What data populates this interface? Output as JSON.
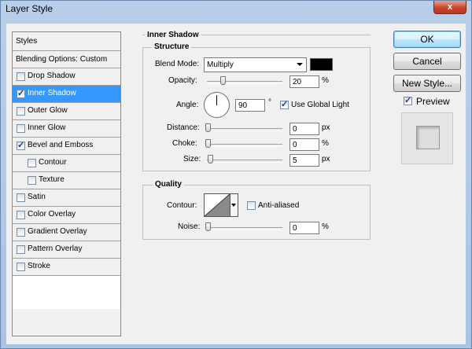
{
  "window": {
    "title": "Layer Style",
    "close_glyph": "x"
  },
  "styles_panel": {
    "header": "Styles",
    "blending": "Blending Options: Custom",
    "items": [
      {
        "label": "Drop Shadow",
        "checked": false,
        "selected": false,
        "indent": false
      },
      {
        "label": "Inner Shadow",
        "checked": true,
        "selected": true,
        "indent": false
      },
      {
        "label": "Outer Glow",
        "checked": false,
        "selected": false,
        "indent": false
      },
      {
        "label": "Inner Glow",
        "checked": false,
        "selected": false,
        "indent": false
      },
      {
        "label": "Bevel and Emboss",
        "checked": true,
        "selected": false,
        "indent": false
      },
      {
        "label": "Contour",
        "checked": false,
        "selected": false,
        "indent": true
      },
      {
        "label": "Texture",
        "checked": false,
        "selected": false,
        "indent": true
      },
      {
        "label": "Satin",
        "checked": false,
        "selected": false,
        "indent": false
      },
      {
        "label": "Color Overlay",
        "checked": false,
        "selected": false,
        "indent": false
      },
      {
        "label": "Gradient Overlay",
        "checked": false,
        "selected": false,
        "indent": false
      },
      {
        "label": "Pattern Overlay",
        "checked": false,
        "selected": false,
        "indent": false
      },
      {
        "label": "Stroke",
        "checked": false,
        "selected": false,
        "indent": false
      }
    ]
  },
  "inner_shadow": {
    "title": "Inner Shadow",
    "structure": {
      "title": "Structure",
      "blend_mode_label": "Blend Mode:",
      "blend_mode_value": "Multiply",
      "shadow_color": "#000000",
      "opacity_label": "Opacity:",
      "opacity_value": "20",
      "opacity_unit": "%",
      "opacity_level": 0.2,
      "angle_label": "Angle:",
      "angle_value": "90",
      "angle_unit": "°",
      "use_global_light_label": "Use Global Light",
      "use_global_light_checked": true,
      "distance_label": "Distance:",
      "distance_value": "0",
      "distance_unit": "px",
      "distance_level": 0,
      "choke_label": "Choke:",
      "choke_value": "0",
      "choke_unit": "%",
      "choke_level": 0,
      "size_label": "Size:",
      "size_value": "5",
      "size_unit": "px",
      "size_level": 0.03
    },
    "quality": {
      "title": "Quality",
      "contour_label": "Contour:",
      "anti_aliased_label": "Anti-aliased",
      "anti_aliased_checked": false,
      "noise_label": "Noise:",
      "noise_value": "0",
      "noise_unit": "%",
      "noise_level": 0
    }
  },
  "buttons": {
    "ok": "OK",
    "cancel": "Cancel",
    "new_style": "New Style...",
    "preview_label": "Preview",
    "preview_checked": true
  },
  "colors": {
    "selection": "#3399ff",
    "dialog_bg": "#f0f0f0",
    "title_bar": "#b8cfe8",
    "close_button": "#c8452c"
  }
}
